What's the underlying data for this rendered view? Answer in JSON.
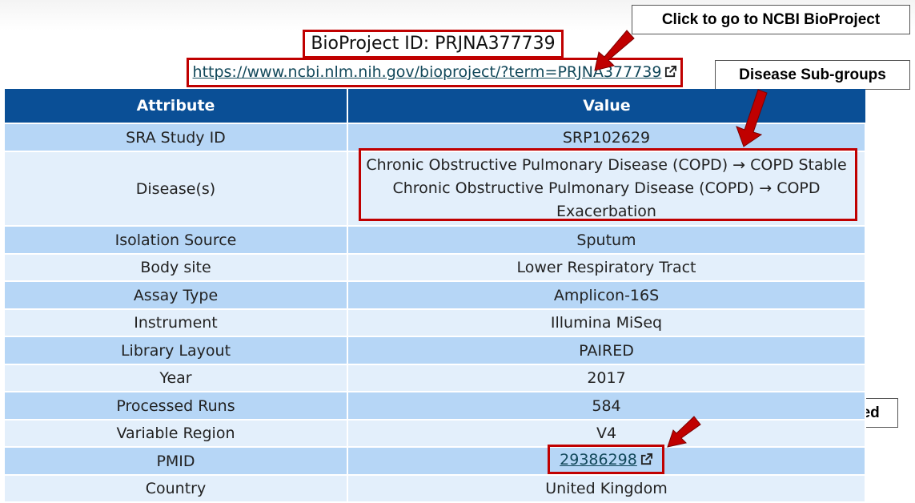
{
  "header": {
    "title": "BioProject ID: PRJNA377739",
    "url": "https://www.ncbi.nlm.nih.gov/bioproject/?term=PRJNA377739"
  },
  "callouts": {
    "ncbi": "Click to go to NCBI BioProject",
    "disease": "Disease Sub-groups",
    "pubmed": "Click to go to PubMed"
  },
  "table": {
    "headers": [
      "Attribute",
      "Value"
    ],
    "rows": [
      {
        "attribute": "SRA Study ID",
        "value": "SRP102629"
      },
      {
        "attribute": "Disease(s)",
        "value_lines": [
          "Chronic Obstructive Pulmonary Disease (COPD) → COPD Stable",
          "Chronic Obstructive Pulmonary Disease (COPD) → COPD",
          "Exacerbation"
        ]
      },
      {
        "attribute": "Isolation Source",
        "value": "Sputum"
      },
      {
        "attribute": "Body site",
        "value": "Lower Respiratory Tract"
      },
      {
        "attribute": "Assay Type",
        "value": "Amplicon-16S"
      },
      {
        "attribute": "Instrument",
        "value": "Illumina MiSeq"
      },
      {
        "attribute": "Library Layout",
        "value": "PAIRED"
      },
      {
        "attribute": "Year",
        "value": "2017"
      },
      {
        "attribute": "Processed Runs",
        "value": "584"
      },
      {
        "attribute": "Variable Region",
        "value": "V4"
      },
      {
        "attribute": "PMID",
        "value": "29386298"
      },
      {
        "attribute": "Country",
        "value": "United Kingdom"
      }
    ]
  },
  "colors": {
    "header_bg": "#0a4f96",
    "row_dark": "#b6d6f6",
    "row_light": "#e3effb",
    "highlight": "#c00000",
    "link": "#12485a"
  },
  "icons": [
    "external-link-icon",
    "arrow-icon"
  ]
}
